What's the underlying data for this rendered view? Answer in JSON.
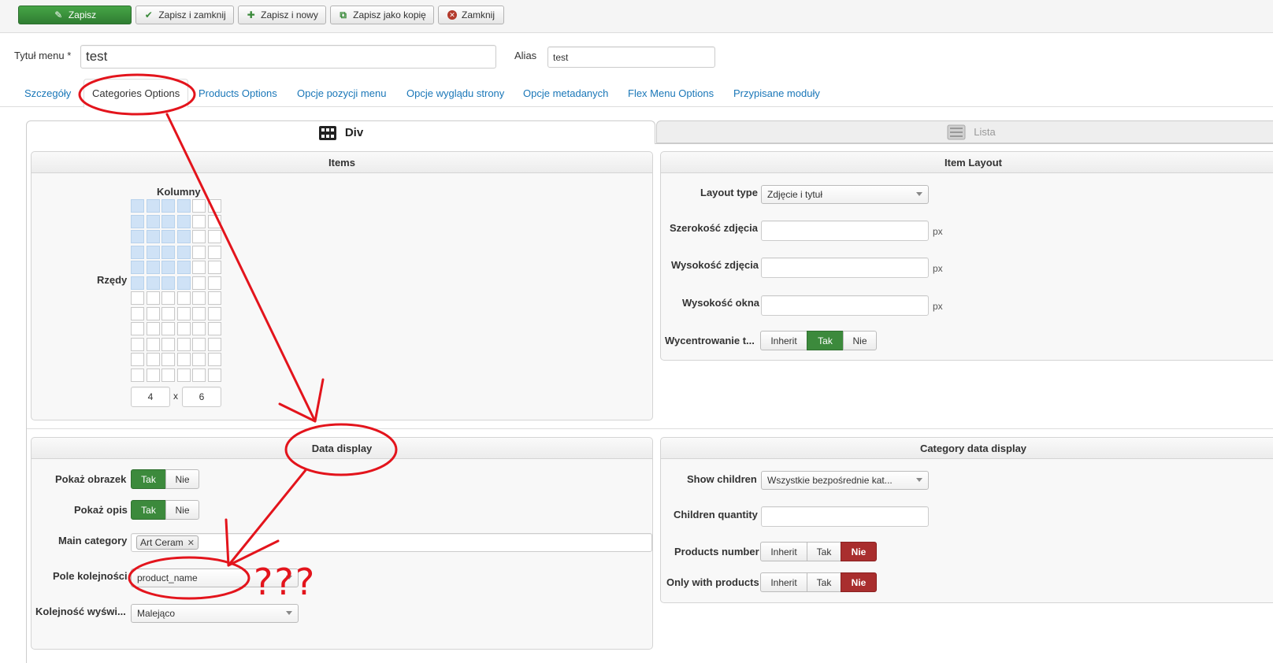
{
  "toolbar": {
    "save": "Zapisz",
    "save_close": "Zapisz i zamknij",
    "save_new": "Zapisz i nowy",
    "save_copy": "Zapisz jako kopię",
    "close": "Zamknij"
  },
  "title_row": {
    "title_label": "Tytuł menu *",
    "title_value": "test",
    "alias_label": "Alias",
    "alias_value": "test"
  },
  "tabs": [
    {
      "label": "Szczegóły"
    },
    {
      "label": "Categories Options",
      "active": true
    },
    {
      "label": "Products Options"
    },
    {
      "label": "Opcje pozycji menu"
    },
    {
      "label": "Opcje wyglądu strony"
    },
    {
      "label": "Opcje metadanych"
    },
    {
      "label": "Flex Menu Options"
    },
    {
      "label": "Przypisane moduły"
    }
  ],
  "layout_tabs": {
    "div": "Div",
    "list": "Lista"
  },
  "items_panel": {
    "title": "Items",
    "columns_label": "Kolumny",
    "rows_label": "Rzędy",
    "grid_columns": 6,
    "grid_rows": 12,
    "selected_columns": 4,
    "selected_rows": 6,
    "columns_value": "4",
    "x_sep": "x",
    "rows_value": "6"
  },
  "item_layout": {
    "title": "Item Layout",
    "layout_type_label": "Layout type",
    "layout_type_value": "Zdjęcie i tytuł",
    "img_width_label": "Szerokość zdjęcia",
    "img_height_label": "Wysokość zdjęcia",
    "win_height_label": "Wysokość okna",
    "unit": "px",
    "center_label": "Wycentrowanie t...",
    "center_options": [
      "Inherit",
      "Tak",
      "Nie"
    ],
    "center_selected": "Tak"
  },
  "data_display": {
    "title": "Data display",
    "show_image_label": "Pokaż obrazek",
    "show_desc_label": "Pokaż opis",
    "yes": "Tak",
    "no": "Nie",
    "main_category_label": "Main category",
    "main_category_chip": "Art Ceram",
    "order_field_label": "Pole kolejności",
    "order_field_value": "product_name",
    "order_dir_label": "Kolejność wyświ...",
    "order_dir_value": "Malejąco"
  },
  "category_display": {
    "title": "Category data display",
    "show_children_label": "Show children",
    "show_children_value": "Wszystkie bezpośrednie kat...",
    "children_qty_label": "Children quantity",
    "products_number_label": "Products number",
    "only_with_products_label": "Only with products",
    "options": [
      "Inherit",
      "Tak",
      "Nie"
    ],
    "selected": "Nie"
  },
  "annotation": {
    "question_marks": "???",
    "color": "#e3141c"
  },
  "colors": {
    "link": "#1a77b8",
    "green": "#3c8a3c",
    "red": "#a92e2e",
    "grid_selected": "#cfe2f6"
  }
}
